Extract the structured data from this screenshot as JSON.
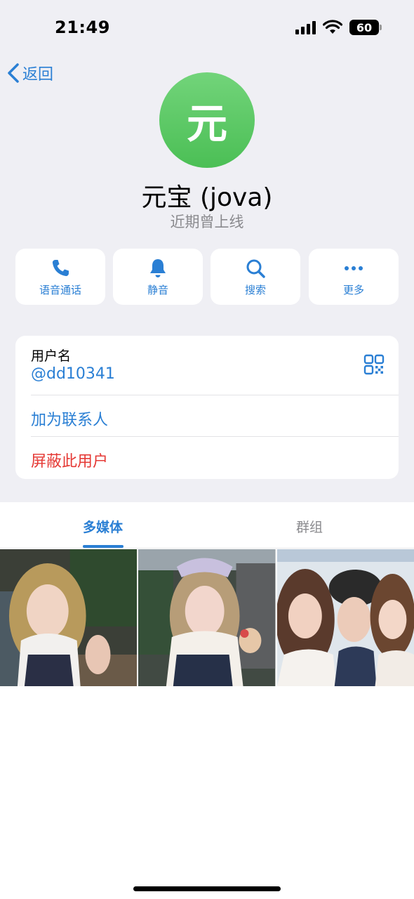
{
  "status_bar": {
    "time": "21:49",
    "battery": "60"
  },
  "nav": {
    "back_label": "返回"
  },
  "profile": {
    "avatar_initial": "元",
    "name": "元宝 (jova)",
    "status": "近期曾上线",
    "avatar_color": "#5cc862"
  },
  "actions": [
    {
      "label": "语音通话",
      "icon": "phone-icon"
    },
    {
      "label": "静音",
      "icon": "bell-icon"
    },
    {
      "label": "搜索",
      "icon": "search-icon"
    },
    {
      "label": "更多",
      "icon": "more-icon"
    }
  ],
  "info": {
    "username_label": "用户名",
    "username": "@dd10341",
    "add_contact": "加为联系人",
    "block_user": "屏蔽此用户"
  },
  "tabs": [
    {
      "label": "多媒体",
      "active": true
    },
    {
      "label": "群组",
      "active": false
    }
  ],
  "media": [
    {
      "type": "photo"
    },
    {
      "type": "photo"
    },
    {
      "type": "photo"
    }
  ],
  "colors": {
    "accent": "#2a7fd4",
    "destructive": "#e53935",
    "background": "#efeff4"
  }
}
